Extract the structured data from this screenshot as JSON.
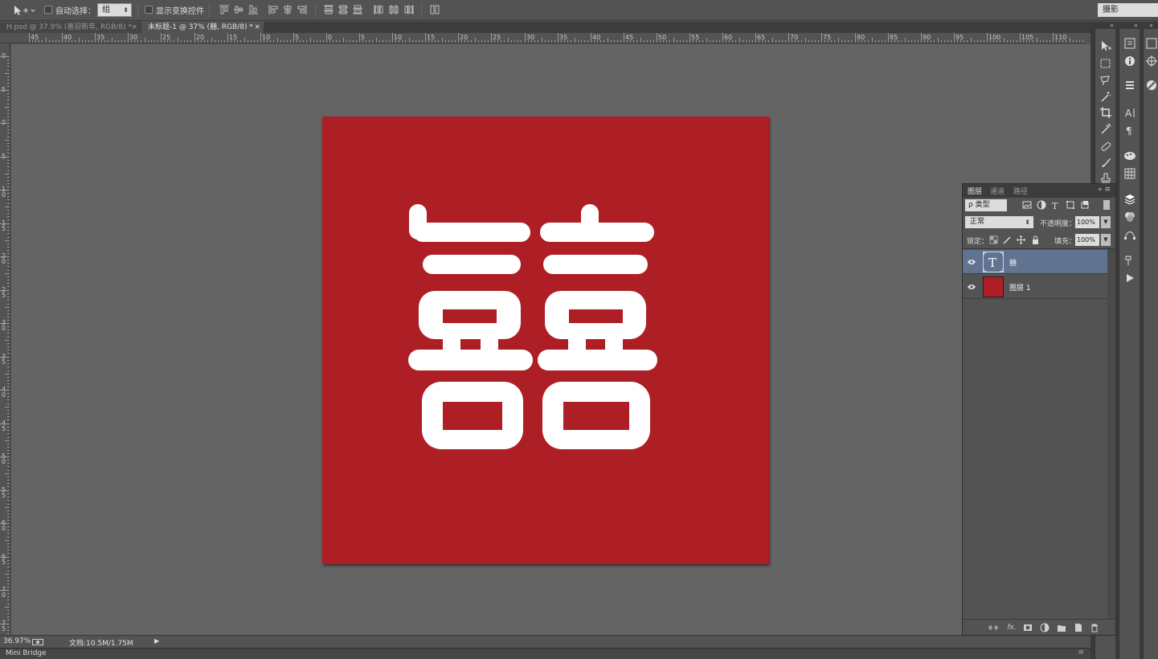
{
  "options_bar": {
    "auto_select_label": "自动选择：",
    "auto_select_value": "组",
    "show_transform_label": "显示变换控件",
    "workspace": "摄影"
  },
  "tabs": [
    {
      "label": "H.psd @ 37.9% (喜迎新年, RGB/8) *",
      "close": "×"
    },
    {
      "label": "未标题-1 @ 37% (囍, RGB/8) *",
      "close": "×"
    }
  ],
  "ruler_top": [
    "45",
    "40",
    "35",
    "30",
    "25",
    "20",
    "15",
    "10",
    "5",
    "0",
    "5",
    "10",
    "15",
    "20",
    "25",
    "30",
    "35",
    "40",
    "45",
    "50",
    "55",
    "60",
    "65",
    "70",
    "75",
    "80",
    "85",
    "90",
    "95",
    "100",
    "105",
    "110"
  ],
  "ruler_left": [
    "0",
    "5",
    "0",
    "5",
    "1 0",
    "1 5",
    "2 0",
    "2 5",
    "3 0",
    "3 5",
    "4 0",
    "4 5",
    "5 0",
    "5 5",
    "6 0",
    "6 5",
    "7 0",
    "7 5"
  ],
  "status": {
    "zoom": "36.97%",
    "doc_info": "文档:10.5M/1.75M",
    "arrow": "▶"
  },
  "mini_bridge": {
    "label": "Mini Bridge",
    "menu": "≡"
  },
  "layers_panel": {
    "tabs": [
      "图层",
      "通道",
      "路径"
    ],
    "menu": "»  ≡",
    "filter_kind": "ρ 类型",
    "blend_mode": "正常",
    "opacity_label": "不透明度：",
    "opacity_value": "100%",
    "lock_label": "锁定：",
    "fill_label": "填充：",
    "fill_value": "100%",
    "layers": [
      {
        "name": "囍",
        "thumb": "T",
        "selected": true
      },
      {
        "name": "图层 1",
        "thumb": "",
        "selected": false
      }
    ],
    "footer_icons": [
      "link-icon",
      "fx-icon",
      "mask-icon",
      "adjustment-icon",
      "folder-icon",
      "new-layer-icon",
      "trash-icon"
    ],
    "footer_fx": "fx."
  },
  "colors": {
    "document_red": "#ad1e25",
    "glyph_white": "#ffffff",
    "selected_layer": "#627391"
  },
  "document_glyph": "囍"
}
